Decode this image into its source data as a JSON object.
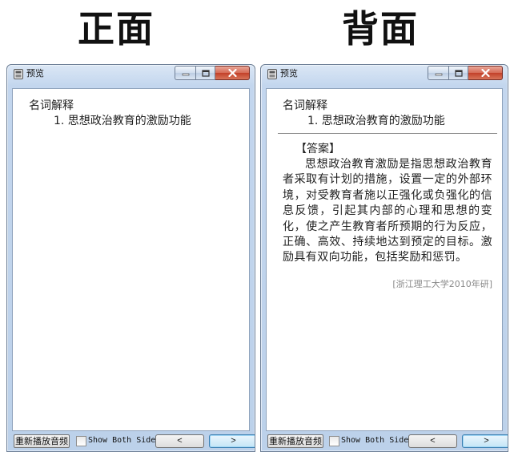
{
  "headings": {
    "front": "正面",
    "back": "背面"
  },
  "window": {
    "title": "预览",
    "controls": {
      "minimize": "minimize-icon",
      "maximize": "maximize-icon",
      "close": "close-icon"
    }
  },
  "card": {
    "section": "名词解释",
    "question": "1. 思想政治教育的激励功能",
    "answer_tag": "【答案】",
    "answer_text": "思想政治教育激励是指思想政治教育者采取有计划的措施，设置一定的外部环境，对受教育者施以正强化或负强化的信息反馈，引起其内部的心理和思想的变化，使之产生教育者所预期的行为反应，正确、高效、持续地达到预定的目标。激励具有双向功能，包括奖励和惩罚。",
    "source": "[浙江理工大学2010年研]"
  },
  "toolbar": {
    "replay_label": "重新播放音频",
    "show_both_label": "Show Both Sides",
    "prev_label": "<",
    "next_label": ">"
  },
  "colors": {
    "titlebar": "#c3d6ee",
    "close_button": "#c3412a",
    "next_button_border": "#3c7fb1"
  }
}
